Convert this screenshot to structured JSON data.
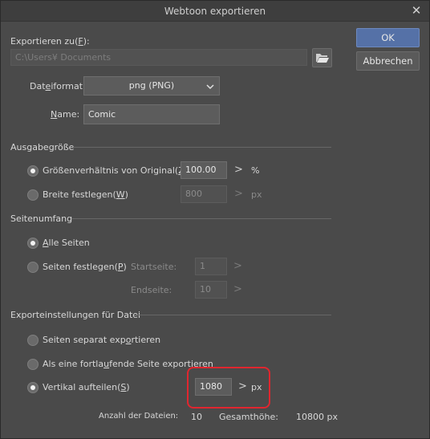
{
  "window": {
    "title": "Webtoon exportieren",
    "close_icon": "close-icon"
  },
  "buttons": {
    "ok": "OK",
    "cancel": "Abbrechen"
  },
  "export_to": {
    "label": "Exportieren zu(F):",
    "path": "C:\\Users¥        Documents",
    "folder_icon": "folder-open-icon"
  },
  "file_format": {
    "label": "Dateiformat:",
    "value": "png (PNG)"
  },
  "name": {
    "label": "Name:",
    "value": "Comic"
  },
  "output_size": {
    "heading": "Ausgabegröße",
    "ratio": {
      "label": "Größenverhältnis von Original(Z)",
      "value": "100.00",
      "unit": "%"
    },
    "width": {
      "label": "Breite festlegen(W)",
      "value": "800",
      "unit": "px"
    }
  },
  "page_range": {
    "heading": "Seitenumfang",
    "all_pages": "Alle Seiten",
    "set_pages": "Seiten festlegen(P)",
    "start": {
      "label": "Startseite:",
      "value": "1"
    },
    "end": {
      "label": "Endseite:",
      "value": "10"
    }
  },
  "file_settings": {
    "heading": "Exporteinstellungen für Datei",
    "separate": "Seiten separat exportieren",
    "continuous": "Als eine fortlaufende Seite exportieren",
    "split": {
      "label": "Vertikal aufteilen(S)",
      "value": "1080",
      "unit": "px"
    }
  },
  "summary": {
    "files_label": "Anzahl der Dateien:",
    "files_value": "10",
    "height_label": "Gesamthöhe:",
    "height_value": "10800 px"
  },
  "colors": {
    "accent_button": "#5571a7",
    "highlight": "#e0262f"
  }
}
